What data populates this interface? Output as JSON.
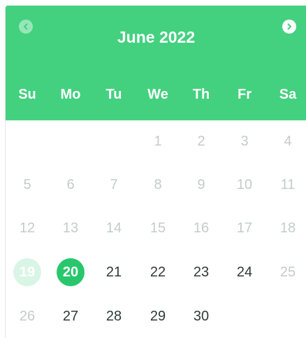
{
  "calendar": {
    "month_title": "June 2022",
    "prev_icon": "chevron-left-icon",
    "next_icon": "chevron-right-icon",
    "colors": {
      "header": "#43d17f",
      "selected": "#29c76d",
      "today_highlight": "#d9f5e5",
      "active_text": "#2e3b36",
      "disabled_text": "#c3ccc8"
    },
    "weekdays": [
      "Su",
      "Mo",
      "Tu",
      "We",
      "Th",
      "Fr",
      "Sa"
    ],
    "days": [
      {
        "label": "1",
        "state": "disabled"
      },
      {
        "label": "2",
        "state": "disabled"
      },
      {
        "label": "3",
        "state": "disabled"
      },
      {
        "label": "4",
        "state": "disabled"
      },
      {
        "label": "5",
        "state": "disabled"
      },
      {
        "label": "6",
        "state": "disabled"
      },
      {
        "label": "7",
        "state": "disabled"
      },
      {
        "label": "8",
        "state": "disabled"
      },
      {
        "label": "9",
        "state": "disabled"
      },
      {
        "label": "10",
        "state": "disabled"
      },
      {
        "label": "11",
        "state": "disabled"
      },
      {
        "label": "12",
        "state": "disabled"
      },
      {
        "label": "13",
        "state": "disabled"
      },
      {
        "label": "14",
        "state": "disabled"
      },
      {
        "label": "15",
        "state": "disabled"
      },
      {
        "label": "16",
        "state": "disabled"
      },
      {
        "label": "17",
        "state": "disabled"
      },
      {
        "label": "18",
        "state": "disabled"
      },
      {
        "label": "19",
        "state": "highlight"
      },
      {
        "label": "20",
        "state": "selected"
      },
      {
        "label": "21",
        "state": "active"
      },
      {
        "label": "22",
        "state": "active"
      },
      {
        "label": "23",
        "state": "active"
      },
      {
        "label": "24",
        "state": "active"
      },
      {
        "label": "25",
        "state": "disabled"
      },
      {
        "label": "26",
        "state": "disabled"
      },
      {
        "label": "27",
        "state": "active"
      },
      {
        "label": "28",
        "state": "active"
      },
      {
        "label": "29",
        "state": "active"
      },
      {
        "label": "30",
        "state": "active"
      }
    ]
  }
}
